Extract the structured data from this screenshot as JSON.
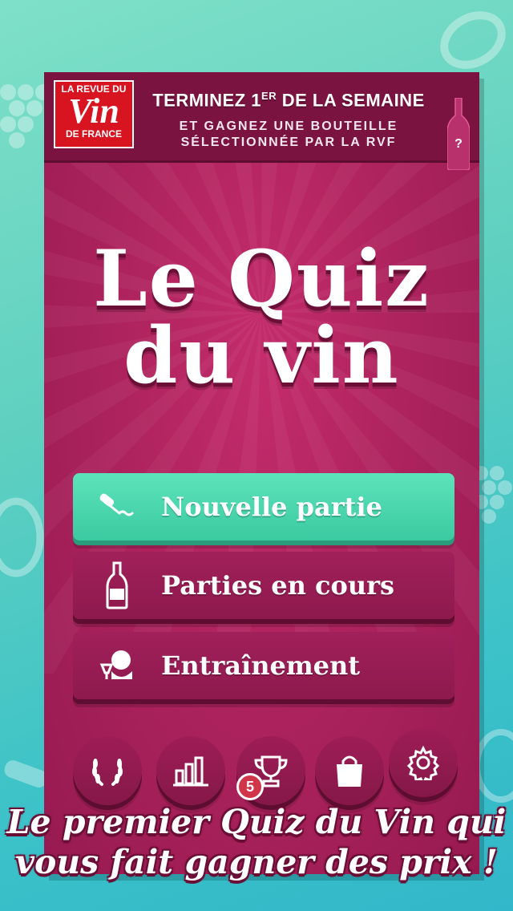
{
  "promo": {
    "logo_line1": "LA REVUE DU",
    "logo_line2": "Vin",
    "logo_line3": "DE FRANCE",
    "title_pre": "TERMINEZ 1",
    "title_sup": "ER",
    "title_post": " DE LA SEMAINE",
    "subtitle_line1": "ET GAGNEZ UNE BOUTEILLE",
    "subtitle_line2": "SÉLECTIONNÉE PAR LA RVF",
    "bottle_mark": "?"
  },
  "title": {
    "line1": "Le Quiz",
    "line2": "du vin"
  },
  "menu": {
    "new_game": "Nouvelle partie",
    "games_in_progress": "Parties en cours",
    "training": "Entraînement"
  },
  "bottom_bar": {
    "trophy_badge_count": "5",
    "icons": [
      "laurel-icon",
      "stats-icon",
      "trophy-icon",
      "shop-bag-icon",
      "gear-icon"
    ]
  },
  "tagline": {
    "line1": "Le premier Quiz du Vin qui",
    "line2": "vous fait gagner des prix !"
  },
  "colors": {
    "panel": "#a51d58",
    "promo_bar": "#7a1340",
    "primary_button": "#4fd6ae",
    "secondary_button": "#951c52",
    "background": "#5fd0c0"
  }
}
